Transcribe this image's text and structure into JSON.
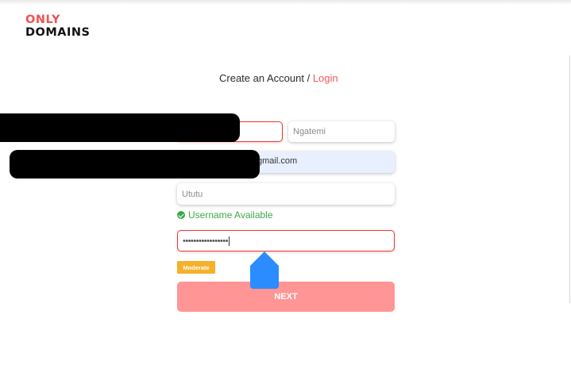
{
  "logo": {
    "top": "ONLY",
    "bottom": "DOMAINS"
  },
  "heading": {
    "create_text": "Create an Account /",
    "login_link": "Login"
  },
  "form": {
    "first_name": {
      "value": ""
    },
    "last_name": {
      "placeholder": "Ngatemi"
    },
    "email": {
      "visible_value": "gmail.com"
    },
    "username": {
      "placeholder": "Ututu",
      "status": "Username Available"
    },
    "password": {
      "masked_value": "•••••••••••••••••"
    },
    "strength_label": "Moderate",
    "next_label": "NEXT"
  },
  "colors": {
    "brand_red": "#f05252",
    "success_green": "#3fa84a",
    "moderate_orange": "#f6b02a",
    "next_button": "#ff9595",
    "cursor_blue": "#2a8cff"
  },
  "icons": {
    "status": "check-circle-icon",
    "pointer": "mouse-pointer-icon"
  }
}
